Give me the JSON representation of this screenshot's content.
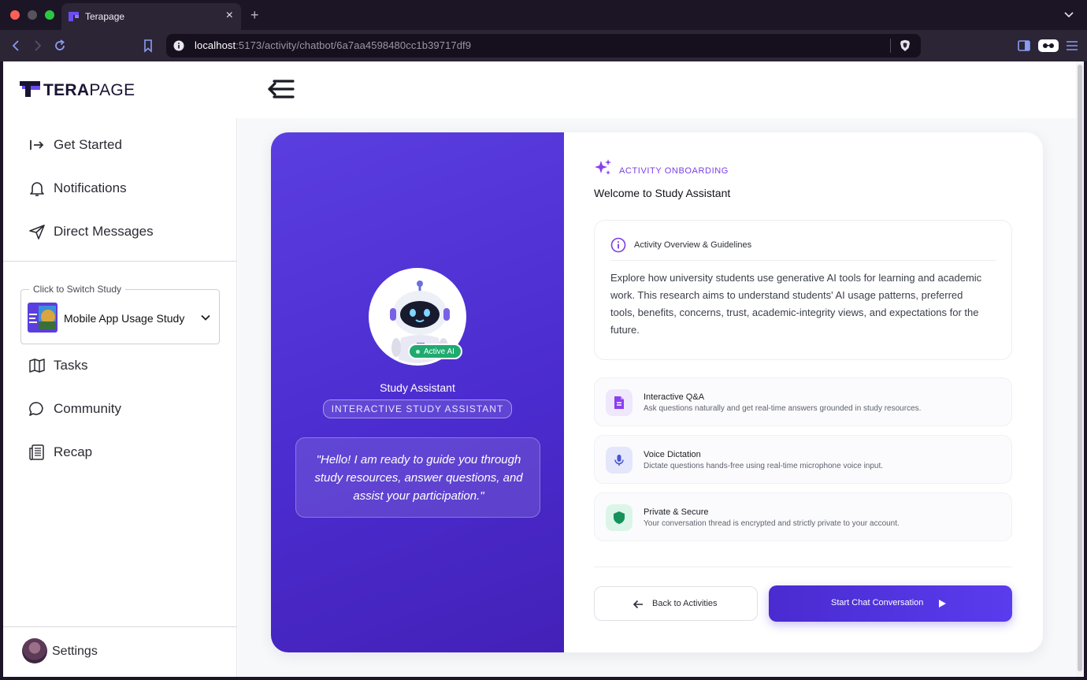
{
  "browser": {
    "tab_title": "Terapage",
    "url_host": "localhost",
    "url_path": ":5173/activity/chatbot/6a7aa4598480cc1b39717df9"
  },
  "app": {
    "logo_text_bold": "TERA",
    "logo_text_rest": "PAGE",
    "brand_color": "#5b3ee0"
  },
  "sidebar": {
    "items_top": [
      {
        "label": "Get Started",
        "icon": "arrow-right-to-line-icon"
      },
      {
        "label": "Notifications",
        "icon": "bell-icon"
      },
      {
        "label": "Direct Messages",
        "icon": "send-icon"
      }
    ],
    "study_switch": {
      "legend": "Click to Switch Study",
      "selected": "Mobile App Usage Study"
    },
    "items_bottom": [
      {
        "label": "Tasks",
        "icon": "map-icon"
      },
      {
        "label": "Community",
        "icon": "chat-bubble-icon"
      },
      {
        "label": "Recap",
        "icon": "newspaper-icon"
      }
    ],
    "settings_label": "Settings"
  },
  "assistant": {
    "status": "Active AI",
    "name": "Study Assistant",
    "role": "INTERACTIVE STUDY ASSISTANT",
    "quote": "\"Hello! I am ready to guide you through study resources, answer questions, and assist your participation.\""
  },
  "onboarding": {
    "label": "ACTIVITY ONBOARDING",
    "welcome": "Welcome to Study Assistant",
    "overview_title": "Activity Overview & Guidelines",
    "overview_text": "Explore how university students use generative AI tools for learning and academic work. This research aims to understand students' AI usage patterns, preferred tools, benefits, concerns, trust, academic-integrity views, and expectations for the future.",
    "features": [
      {
        "title": "Interactive Q&A",
        "desc": "Ask questions naturally and get real-time answers grounded in study resources.",
        "icon": "document-icon"
      },
      {
        "title": "Voice Dictation",
        "desc": "Dictate questions hands-free using real-time microphone voice input.",
        "icon": "microphone-icon"
      },
      {
        "title": "Private & Secure",
        "desc": "Your conversation thread is encrypted and strictly private to your account.",
        "icon": "shield-icon"
      }
    ],
    "back_label": "Back to Activities",
    "start_label": "Start Chat Conversation"
  }
}
